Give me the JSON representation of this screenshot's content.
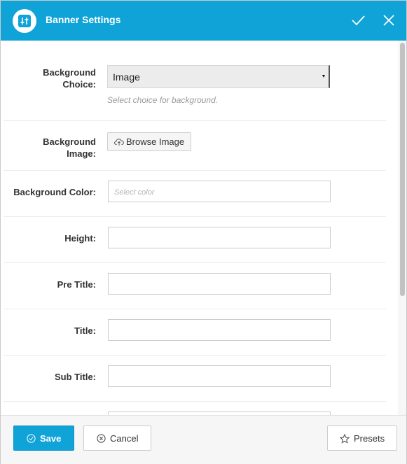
{
  "header": {
    "title": "Banner Settings",
    "accent_color": "#0fa3d8"
  },
  "fields": {
    "background_choice": {
      "label_line1": "Background",
      "label_line2": "Choice:",
      "selected": "Image",
      "help": "Select choice for background."
    },
    "background_image": {
      "label_line1": "Background",
      "label_line2": "Image:",
      "button_label": "Browse Image"
    },
    "background_color": {
      "label": "Background Color:",
      "placeholder": "Select color",
      "value": ""
    },
    "height": {
      "label": "Height:",
      "value": ""
    },
    "pre_title": {
      "label": "Pre Title:",
      "value": ""
    },
    "title": {
      "label": "Title:",
      "value": ""
    },
    "sub_title": {
      "label": "Sub Title:",
      "value": ""
    }
  },
  "footer": {
    "save_label": "Save",
    "cancel_label": "Cancel",
    "presets_label": "Presets"
  },
  "icons": {
    "header_logo": "settings-sliders-icon",
    "confirm": "check-icon",
    "close": "close-icon",
    "browse": "cloud-upload-icon",
    "save": "check-circle-icon",
    "cancel": "x-circle-icon",
    "presets": "star-icon"
  }
}
